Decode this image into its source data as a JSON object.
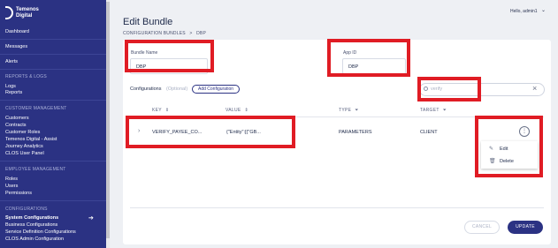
{
  "brand": {
    "line1": "Temenos",
    "line2": "Digital"
  },
  "sidebar": {
    "items": {
      "dashboard": "Dashboard",
      "messages": "Messages",
      "alerts": "Alerts",
      "logs": "Logs",
      "reports": "Reports",
      "customers": "Customers",
      "contracts": "Contracts",
      "customer_roles": "Customer Roles",
      "temenos_assist": "Temenos Digital - Assist",
      "journey_analytics": "Journey Analytics",
      "clos_user_panel": "CLOS User Panel",
      "roles": "Roles",
      "users": "Users",
      "permissions": "Permissions",
      "system_configurations": "System Configurations",
      "business_configurations": "Business Configurations",
      "service_definition_configurations": "Service Definition Configurations",
      "clos_admin_configuration": "CLOS Admin Configuration"
    },
    "sections": {
      "reports_logs": "REPORTS & LOGS",
      "customer_management": "CUSTOMER MANAGEMENT",
      "employee_management": "EMPLOYEE MANAGEMENT",
      "configurations": "CONFIGURATIONS"
    },
    "active_arrow": "➔"
  },
  "header": {
    "title": "Edit Bundle",
    "breadcrumb": [
      "CONFIGURATION BUNDLES",
      ">",
      "DBP"
    ],
    "greeting": "Hello, admin1",
    "caret": "⌄"
  },
  "form": {
    "bundle_name_label": "Bundle Name",
    "bundle_name_value": "DBP",
    "app_id_label": "App ID",
    "app_id_value": "DBP"
  },
  "configurations": {
    "label": "Configurations",
    "optional": "(Optional)",
    "add_button": "Add Configuration",
    "search_value": "verify",
    "clear": "×"
  },
  "table": {
    "headers": {
      "key": "KEY",
      "value": "VALUE",
      "type": "TYPE",
      "target": "TARGET"
    },
    "sort_glyph": "⇕",
    "filter_glyph": "⏷",
    "rows": [
      {
        "key": "VERIFY_PAYEE_CO...",
        "value": "{\"Entity\":[{\"GB...",
        "type": "PARAMETERS",
        "target": "CLIENT"
      }
    ],
    "expand_glyph": "›",
    "more_glyph": "⋮"
  },
  "row_menu": {
    "edit": "Edit",
    "delete": "Delete",
    "edit_icon": "✎",
    "delete_icon": "🗑"
  },
  "actions": {
    "cancel": "CANCEL",
    "update": "UPDATE"
  },
  "colors": {
    "sidebar": "#2b3283",
    "accent": "#2b3283",
    "highlight": "#e01c24"
  }
}
